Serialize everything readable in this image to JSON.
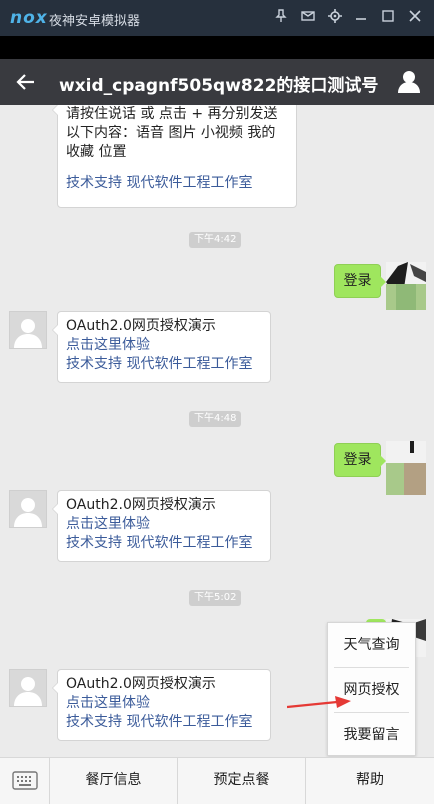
{
  "emulator": {
    "logo": "nox",
    "title": "夜神安卓模拟器",
    "icons": [
      "pin-icon",
      "message-icon",
      "settings-icon",
      "minimize-icon",
      "close-icon"
    ]
  },
  "header": {
    "title": "wxid_cpagnf505qw822的接口测试号"
  },
  "messages": {
    "m0": {
      "line1": "请按住说话 或 点击 + 再分别发送",
      "line2": "以下内容：语音 图片 小视频 我的",
      "line3": "收藏 位置",
      "support": "技术支持 现代软件工程工作室"
    },
    "t1": "下午4:42",
    "o1": "登录",
    "m1": {
      "title": "OAuth2.0网页授权演示",
      "link": "点击这里体验",
      "support": "技术支持 现代软件工程工作室"
    },
    "t2": "下午4:48",
    "o2": "登录",
    "m2": {
      "title": "OAuth2.0网页授权演示",
      "link": "点击这里体验",
      "support": "技术支持 现代软件工程工作室"
    },
    "t3": "下午5:02",
    "m3": {
      "title": "OAuth2.0网页授权演示",
      "link": "点击这里体验",
      "support": "技术支持 现代软件工程工作室"
    }
  },
  "menu": {
    "items": [
      "餐厅信息",
      "预定点餐",
      "帮助"
    ]
  },
  "submenu": {
    "items": [
      "天气查询",
      "网页授权",
      "我要留言"
    ]
  },
  "colors": {
    "emulator_bar": "#26303d",
    "header": "#393a3f",
    "outgoing_bubble": "#9fe65e",
    "link": "#3b5b9a",
    "annotation_arrow": "#e53935"
  }
}
